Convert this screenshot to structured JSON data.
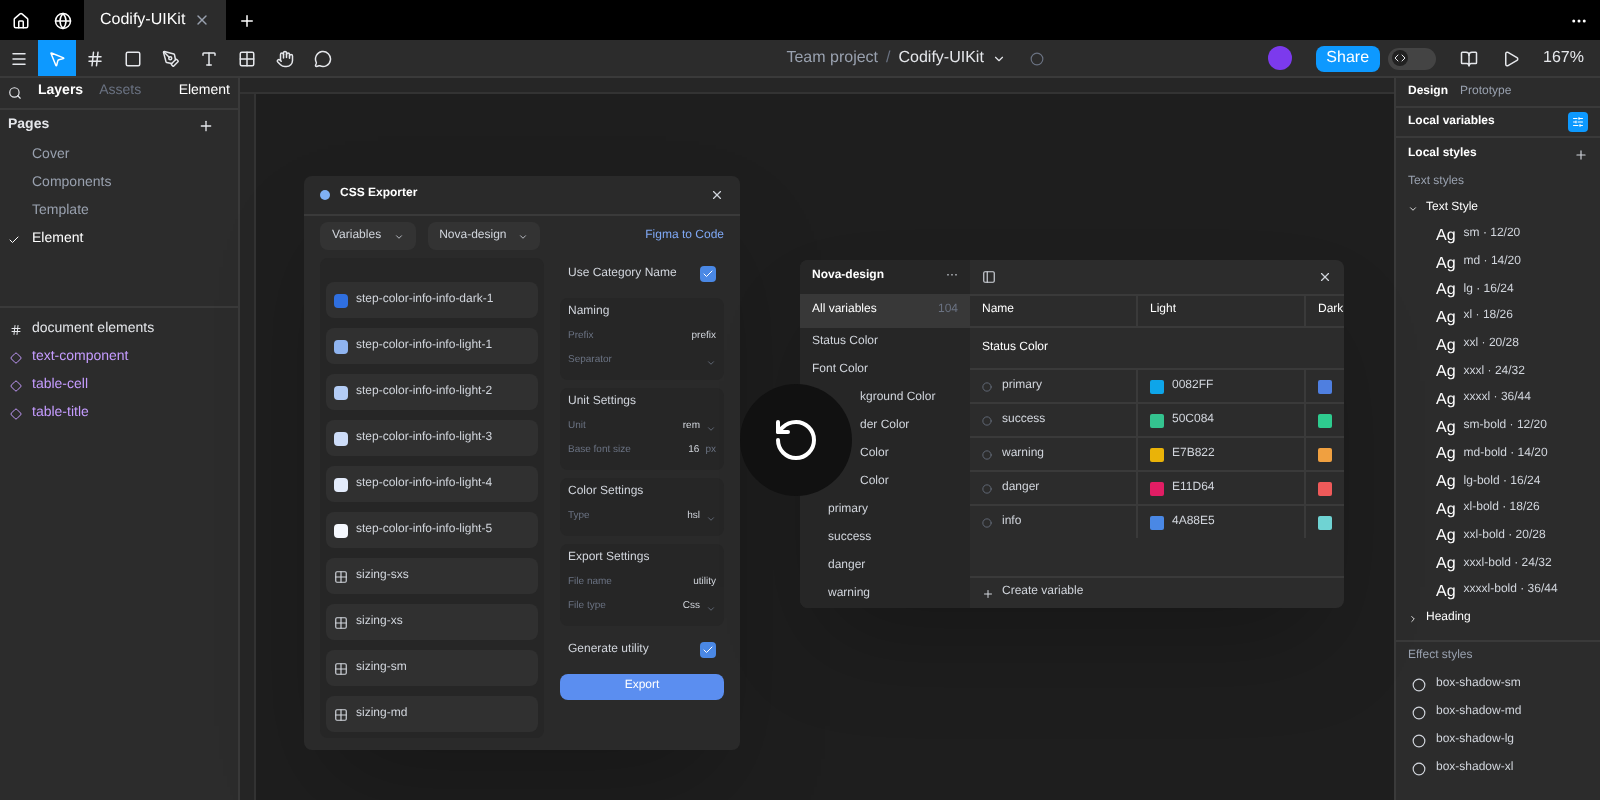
{
  "file_tab": {
    "title": "Codify-UIKit"
  },
  "toolbar": {
    "tools": [
      {
        "kind": "menu",
        "selected": false
      },
      {
        "kind": "move",
        "selected": true
      },
      {
        "kind": "frame",
        "selected": false
      },
      {
        "kind": "shape",
        "selected": false
      },
      {
        "kind": "pen",
        "selected": false
      },
      {
        "kind": "text",
        "selected": false
      },
      {
        "kind": "components",
        "selected": false
      },
      {
        "kind": "hand",
        "selected": false
      },
      {
        "kind": "comment",
        "selected": false
      }
    ],
    "project": "Team project",
    "separator": "/",
    "file": "Codify-UIKit",
    "share": "Share",
    "dev_mode": false,
    "zoom": "167%"
  },
  "left_panel": {
    "tabs": [
      {
        "label": "Layers",
        "selected": true
      },
      {
        "label": "Assets",
        "selected": false
      }
    ],
    "page_menu": "Element",
    "pages_title": "Pages",
    "pages": [
      {
        "label": "Cover",
        "selected": false
      },
      {
        "label": "Components",
        "selected": false
      },
      {
        "label": "Template",
        "selected": false
      },
      {
        "label": "Element",
        "selected": true
      }
    ],
    "layers": [
      {
        "label": "document elements",
        "kind": "frame"
      },
      {
        "label": "text-component",
        "kind": "component"
      },
      {
        "label": "table-cell",
        "kind": "component"
      },
      {
        "label": "table-title",
        "kind": "component"
      }
    ]
  },
  "css_exporter": {
    "title": "CSS Exporter",
    "dropdowns": [
      "Variables",
      "Nova-design"
    ],
    "link": "Figma to Code",
    "tokens": [
      {
        "label": "step-color-info-info-dark-1",
        "kind": "color",
        "color": "#2f6fe0"
      },
      {
        "label": "step-color-info-info-light-1",
        "kind": "color",
        "color": "#8fb4f0"
      },
      {
        "label": "step-color-info-info-light-2",
        "kind": "color",
        "color": "#b3ccf5"
      },
      {
        "label": "step-color-info-info-light-3",
        "kind": "color",
        "color": "#cddcf8"
      },
      {
        "label": "step-color-info-info-light-4",
        "kind": "color",
        "color": "#e3ebfb"
      },
      {
        "label": "step-color-info-info-light-5",
        "kind": "color",
        "color": "#f5f8fe"
      },
      {
        "label": "sizing-sxs",
        "kind": "sizing"
      },
      {
        "label": "sizing-xs",
        "kind": "sizing"
      },
      {
        "label": "sizing-sm",
        "kind": "sizing"
      },
      {
        "label": "sizing-md",
        "kind": "sizing"
      }
    ],
    "use_category": {
      "label": "Use Category Name",
      "checked": true
    },
    "sections": [
      {
        "title": "Naming",
        "fields": [
          {
            "label": "Prefix",
            "value": "prefix",
            "kind": "input"
          },
          {
            "label": "Separator",
            "kind": "select"
          }
        ]
      },
      {
        "title": "Unit Settings",
        "fields": [
          {
            "label": "Unit",
            "value": "rem",
            "kind": "select"
          },
          {
            "label": "Base font size",
            "value": "16",
            "unit": "px",
            "kind": "input"
          }
        ]
      },
      {
        "title": "Color Settings",
        "fields": [
          {
            "label": "Type",
            "value": "hsl",
            "kind": "select"
          }
        ]
      },
      {
        "title": "Export Settings",
        "fields": [
          {
            "label": "File name",
            "value": "utility",
            "kind": "input"
          },
          {
            "label": "File type",
            "value": "Css",
            "kind": "select"
          }
        ]
      }
    ],
    "generate": {
      "label": "Generate utility",
      "checked": true
    },
    "export": "Export"
  },
  "variables": {
    "collection": "Nova-design",
    "more": "···",
    "all": {
      "label": "All variables",
      "count": "104",
      "selected": true
    },
    "groups": [
      {
        "label": "Status Color",
        "kind": "group"
      },
      {
        "label": "Font Color",
        "kind": "group"
      },
      {
        "label": "kground Color",
        "kind": "cut"
      },
      {
        "label": "der Color",
        "kind": "cut"
      },
      {
        "label": "Color",
        "kind": "cut"
      },
      {
        "label": "Color",
        "kind": "cut"
      },
      {
        "label": "primary",
        "kind": "variable"
      },
      {
        "label": "success",
        "kind": "variable"
      },
      {
        "label": "danger",
        "kind": "variable"
      },
      {
        "label": "warning",
        "kind": "variable"
      }
    ],
    "columns": [
      "Name",
      "Light",
      "Dark"
    ],
    "section": "Status Color",
    "rows": [
      {
        "name": "primary",
        "light": {
          "value": "0082FF",
          "color": "#0ea5e9"
        },
        "dark": {
          "color": "#4f7fe0"
        }
      },
      {
        "name": "success",
        "light": {
          "value": "50C084",
          "color": "#34c38f"
        },
        "dark": {
          "color": "#2ecc8f"
        }
      },
      {
        "name": "warning",
        "light": {
          "value": "E7B822",
          "color": "#eab308"
        },
        "dark": {
          "color": "#f0a040"
        }
      },
      {
        "name": "danger",
        "light": {
          "value": "E11D64",
          "color": "#e11d64"
        },
        "dark": {
          "color": "#ef5a5a"
        }
      },
      {
        "name": "info",
        "light": {
          "value": "4A88E5",
          "color": "#4a88e5"
        },
        "dark": {
          "color": "#6fd3d3"
        }
      }
    ],
    "create": "Create variable"
  },
  "right_panel": {
    "tabs": [
      {
        "label": "Design",
        "selected": true
      },
      {
        "label": "Prototype",
        "selected": false
      }
    ],
    "local_variables": "Local variables",
    "local_styles": "Local styles",
    "text_styles": "Text styles",
    "text_group": {
      "label": "Text Style",
      "expanded": true
    },
    "styles": [
      {
        "sample": "Ag",
        "label": "sm · 12/20"
      },
      {
        "sample": "Ag",
        "label": "md · 14/20"
      },
      {
        "sample": "Ag",
        "label": "lg · 16/24"
      },
      {
        "sample": "Ag",
        "label": "xl · 18/26"
      },
      {
        "sample": "Ag",
        "label": "xxl · 20/28"
      },
      {
        "sample": "Ag",
        "label": "xxxl · 24/32"
      },
      {
        "sample": "Ag",
        "label": "xxxxl · 36/44"
      },
      {
        "sample": "Ag",
        "label": "sm-bold · 12/20"
      },
      {
        "sample": "Ag",
        "label": "md-bold · 14/20"
      },
      {
        "sample": "Ag",
        "label": "lg-bold · 16/24"
      },
      {
        "sample": "Ag",
        "label": "xl-bold · 18/26"
      },
      {
        "sample": "Ag",
        "label": "xxl-bold · 20/28"
      },
      {
        "sample": "Ag",
        "label": "xxxl-bold · 24/32"
      },
      {
        "sample": "Ag",
        "label": "xxxxl-bold · 36/44"
      }
    ],
    "heading_group": {
      "label": "Heading",
      "expanded": false
    },
    "effect_styles": "Effect styles",
    "effects": [
      "box-shadow-sm",
      "box-shadow-md",
      "box-shadow-lg",
      "box-shadow-xl"
    ]
  }
}
